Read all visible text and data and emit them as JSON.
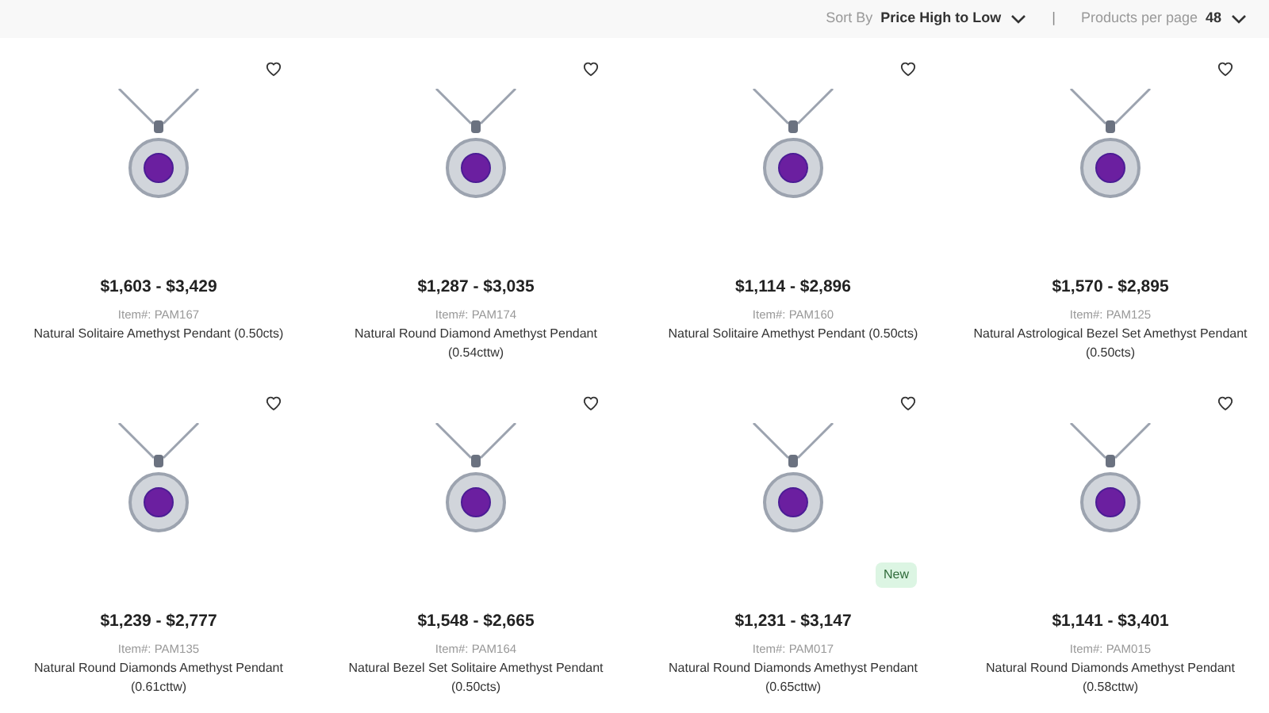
{
  "toolbar": {
    "sort_label": "Sort By",
    "sort_value": "Price High to Low",
    "separator": "|",
    "per_page_label": "Products per page",
    "per_page_value": "48"
  },
  "products": [
    {
      "price": "$1,603 - $3,429",
      "item": "Item#: PAM167",
      "name": "Natural Solitaire Amethyst Pendant (0.50cts)"
    },
    {
      "price": "$1,287 - $3,035",
      "item": "Item#: PAM174",
      "name": "Natural Round Diamond Amethyst Pendant (0.54cttw)"
    },
    {
      "price": "$1,114 - $2,896",
      "item": "Item#: PAM160",
      "name": "Natural Solitaire Amethyst Pendant (0.50cts)"
    },
    {
      "price": "$1,570 - $2,895",
      "item": "Item#: PAM125",
      "name": "Natural Astrological Bezel Set Amethyst Pendant (0.50cts)"
    },
    {
      "price": "$1,239 - $2,777",
      "item": "Item#: PAM135",
      "name": "Natural Round Diamonds Amethyst Pendant (0.61cttw)"
    },
    {
      "price": "$1,548 - $2,665",
      "item": "Item#: PAM164",
      "name": "Natural Bezel Set Solitaire Amethyst Pendant (0.50cts)"
    },
    {
      "price": "$1,231 - $3,147",
      "item": "Item#: PAM017",
      "name": "Natural Round Diamonds Amethyst Pendant (0.65cttw)",
      "badge": "New"
    },
    {
      "price": "$1,141 - $3,401",
      "item": "Item#: PAM015",
      "name": "Natural Round Diamonds Amethyst Pendant (0.58cttw)"
    }
  ]
}
